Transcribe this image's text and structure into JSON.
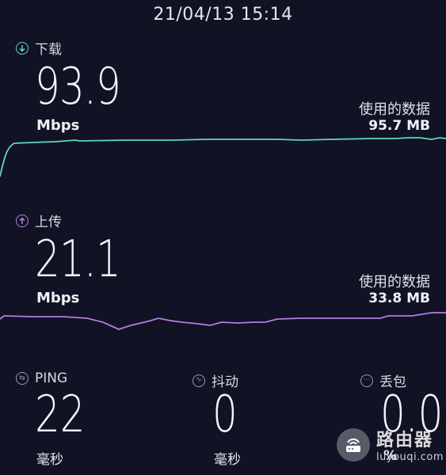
{
  "header": {
    "datetime": "21/04/13 15:14"
  },
  "download": {
    "label": "下载",
    "value": "93.9",
    "unit": "Mbps",
    "data_used_label": "使用的数据",
    "data_used_value": "95.7 MB",
    "color": "#5fd6c4"
  },
  "upload": {
    "label": "上传",
    "value": "21.1",
    "unit": "Mbps",
    "data_used_label": "使用的数据",
    "data_used_value": "33.8 MB",
    "color": "#b57ce6"
  },
  "stats": {
    "ping": {
      "label": "PING",
      "value": "22",
      "unit": "毫秒",
      "icon": "ping-icon"
    },
    "jitter": {
      "label": "抖动",
      "value": "0",
      "unit": "毫秒",
      "icon": "jitter-icon"
    },
    "loss": {
      "label": "丢包",
      "value": "0.0",
      "unit": "%",
      "icon": "packet-loss-icon"
    }
  },
  "watermark": {
    "title": "路由器",
    "subtitle": "luyouqi.com"
  }
}
